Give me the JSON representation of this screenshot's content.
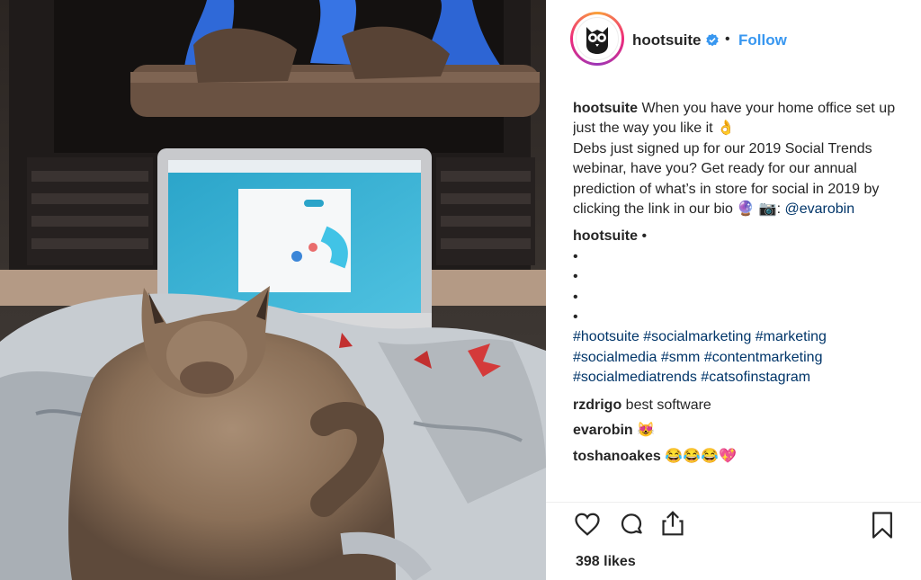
{
  "header": {
    "username": "hootsuite",
    "separator": "•",
    "follow_label": "Follow"
  },
  "caption": {
    "username": "hootsuite",
    "text_line1": "When you have your home office set up just the way you like it 👌",
    "text_line2": "Debs just signed up for our 2019 Social Trends webinar, have you? Get ready for our annual prediction of what’s in store for social in 2019 by clicking the link in our bio 🔮 📷: ",
    "mention": "@evarobin"
  },
  "comment_block": {
    "username": "hootsuite",
    "first_bullet": "•",
    "bullets": [
      "•",
      "•",
      "•",
      "•"
    ],
    "hashtags": "#hootsuite #socialmarketing #marketing #socialmedia #smm #contentmarketing #socialmediatrends #catsofinstagram"
  },
  "comments": [
    {
      "username": "rzdrigo",
      "text": "best software"
    },
    {
      "username": "evarobin",
      "text": "😻"
    },
    {
      "username": "toshanoakes",
      "text": "😂😂😂💖"
    }
  ],
  "likes": "398 likes",
  "colors": {
    "link": "#003569",
    "follow": "#3897f0",
    "text": "#262626",
    "verified": "#3897f0"
  },
  "icons": [
    "hootsuite-owl-icon",
    "verified-icon",
    "heart-icon",
    "comment-icon",
    "share-icon",
    "bookmark-icon",
    "small-heart-icon"
  ]
}
